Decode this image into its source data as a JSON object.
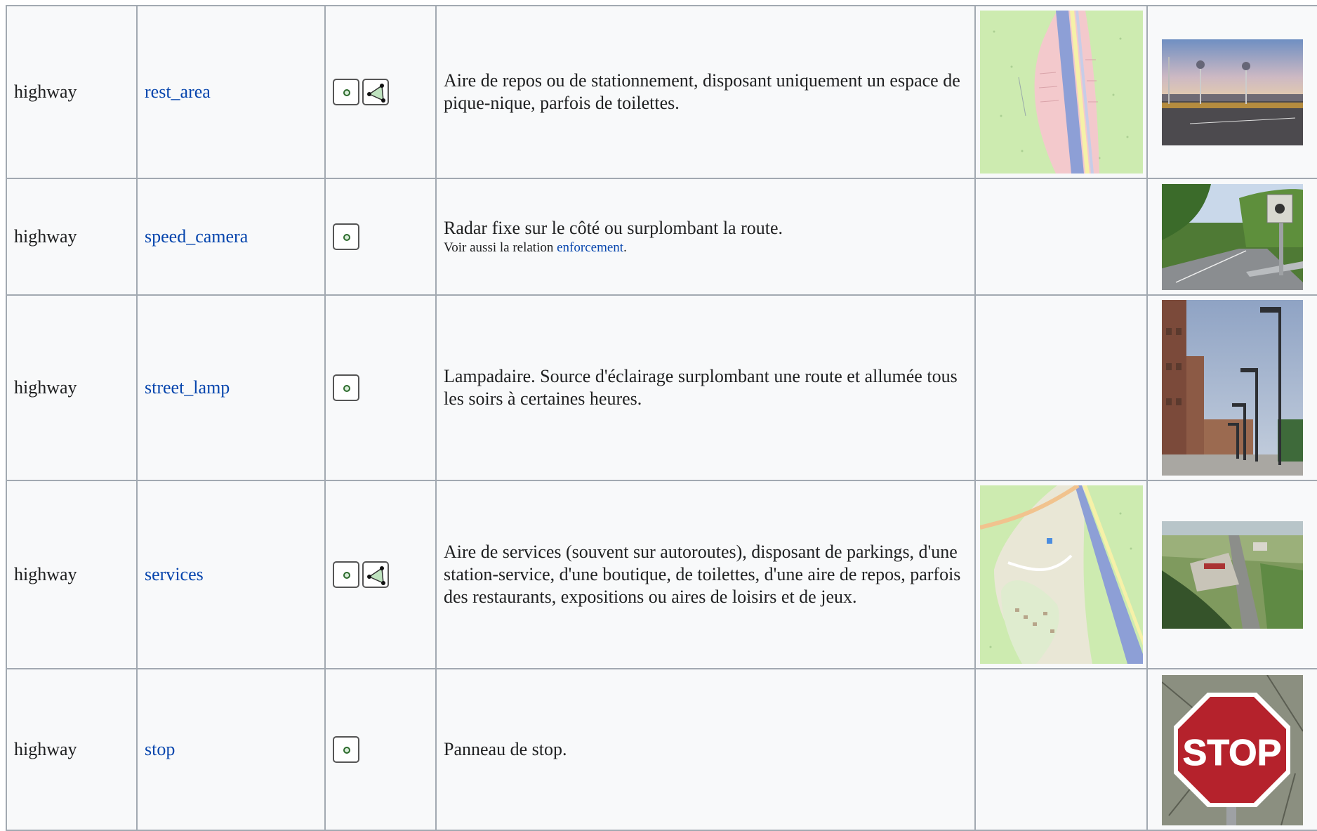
{
  "rows": [
    {
      "key": "highway",
      "value": "rest_area",
      "types": [
        "node",
        "area"
      ],
      "description": "Aire de repos ou de stationnement, disposant uniquement un espace de pique-nique, parfois de toilettes.",
      "note_prefix": "",
      "note_link": "",
      "note_suffix": "",
      "has_rendering": true,
      "photo": "rest-area-photo"
    },
    {
      "key": "highway",
      "value": "speed_camera",
      "types": [
        "node"
      ],
      "description": "Radar fixe sur le côté ou surplombant la route.",
      "note_prefix": "Voir aussi la relation ",
      "note_link": "enforcement",
      "note_suffix": ".",
      "has_rendering": false,
      "photo": "speed-camera-photo"
    },
    {
      "key": "highway",
      "value": "street_lamp",
      "types": [
        "node"
      ],
      "description": "Lampadaire. Source d'éclairage surplombant une route et allumée tous les soirs à certaines heures.",
      "note_prefix": "",
      "note_link": "",
      "note_suffix": "",
      "has_rendering": false,
      "photo": "street-lamp-photo"
    },
    {
      "key": "highway",
      "value": "services",
      "types": [
        "node",
        "area"
      ],
      "description": "Aire de services (souvent sur autoroutes), disposant de parkings, d'une station-service, d'une boutique, de toilettes, d'une aire de repos, parfois des restaurants, expositions ou aires de loisirs et de jeux.",
      "note_prefix": "",
      "note_link": "",
      "note_suffix": "",
      "has_rendering": true,
      "photo": "services-photo"
    },
    {
      "key": "highway",
      "value": "stop",
      "types": [
        "node"
      ],
      "description": "Panneau de stop.",
      "note_prefix": "",
      "note_link": "",
      "note_suffix": "",
      "has_rendering": false,
      "photo": "stop-sign-photo"
    }
  ],
  "colors": {
    "link": "#0645ad",
    "border": "#a2a9b1",
    "cell_bg": "#f8f9fa",
    "map_green": "#cdebb0",
    "motorway": "#8d9fd6",
    "stop_red": "#b5222c"
  },
  "photo_captions": {
    "stop_sign_text": "STOP"
  }
}
